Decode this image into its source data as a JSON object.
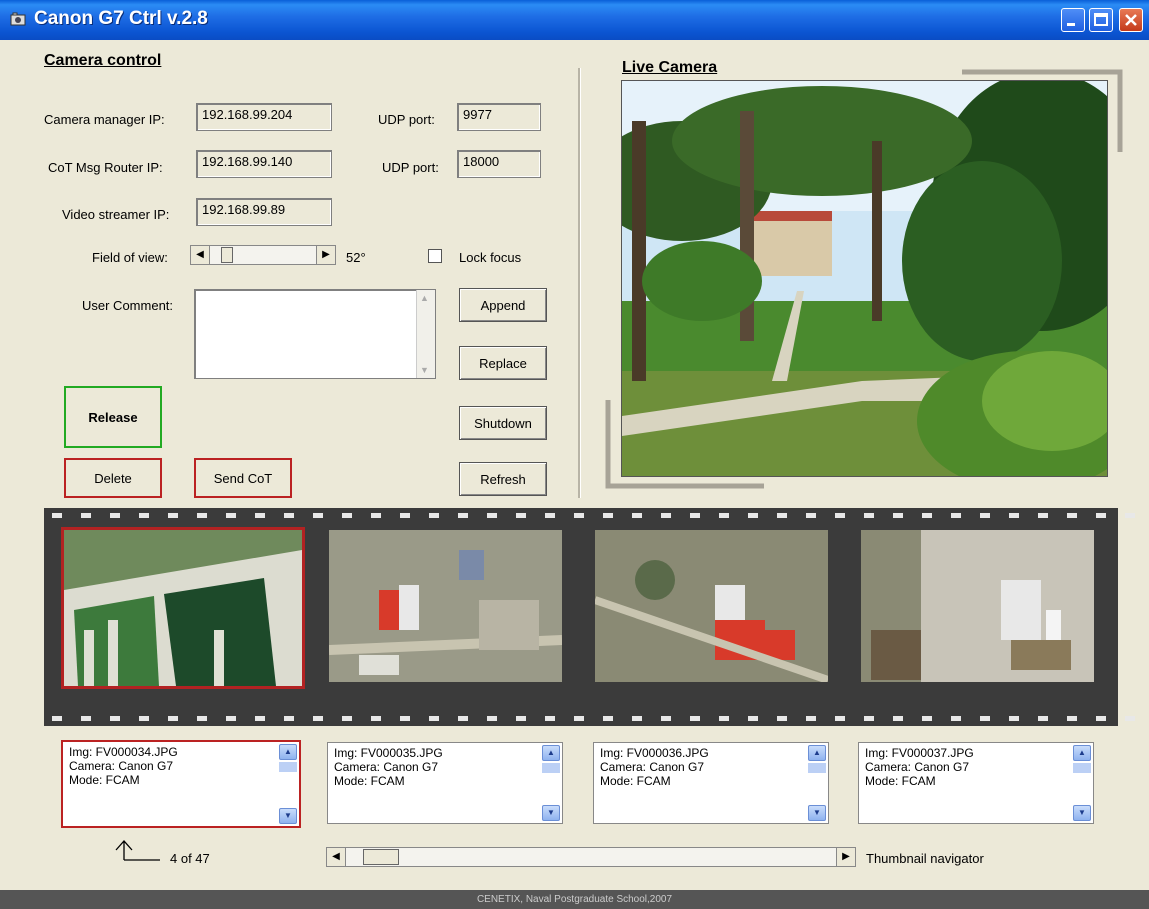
{
  "window": {
    "title": "Canon G7 Ctrl  v.2.8",
    "controls": [
      "minimize-icon",
      "maximize-icon",
      "close-icon"
    ]
  },
  "camera_control": {
    "heading": "Camera control",
    "camera_manager_ip_label": "Camera manager IP:",
    "camera_manager_ip": "192.168.99.204",
    "udp_port_label_1": "UDP port:",
    "udp_port_1": "9977",
    "cot_router_ip_label": "CoT Msg Router IP:",
    "cot_router_ip": "192.168.99.140",
    "udp_port_label_2": "UDP port:",
    "udp_port_2": "18000",
    "video_streamer_ip_label": "Video streamer IP:",
    "video_streamer_ip": "192.168.99.89",
    "field_of_view_label": "Field of view:",
    "field_of_view_value": "52°",
    "field_of_view_level": 0.12,
    "lock_focus_label": "Lock focus",
    "lock_focus_checked": false,
    "user_comment_label": "User Comment:",
    "user_comment_value": "",
    "buttons": {
      "append": "Append",
      "replace": "Replace",
      "shutdown": "Shutdown",
      "refresh": "Refresh",
      "release": "Release",
      "delete": "Delete",
      "send_cot": "Send CoT"
    }
  },
  "live_camera": {
    "heading": "Live Camera"
  },
  "thumbnails": [
    {
      "img": "Img: FV000034.JPG",
      "camera": "Camera: Canon G7",
      "mode": "Mode: FCAM",
      "selected": true
    },
    {
      "img": "Img: FV000035.JPG",
      "camera": "Camera: Canon G7",
      "mode": "Mode: FCAM",
      "selected": false
    },
    {
      "img": "Img: FV000036.JPG",
      "camera": "Camera: Canon G7",
      "mode": "Mode: FCAM",
      "selected": false
    },
    {
      "img": "Img: FV000037.JPG",
      "camera": "Camera: Canon G7",
      "mode": "Mode: FCAM",
      "selected": false
    }
  ],
  "navigator": {
    "position_text": "4 of 47",
    "label": "Thumbnail navigator",
    "position_fraction": 0.04
  },
  "status": {
    "text": "CENETIX, Naval Postgraduate School,2007"
  },
  "colors": {
    "selected_border": "#b22222",
    "release_border": "#22aa22",
    "title_bar": "#0a55d2"
  }
}
